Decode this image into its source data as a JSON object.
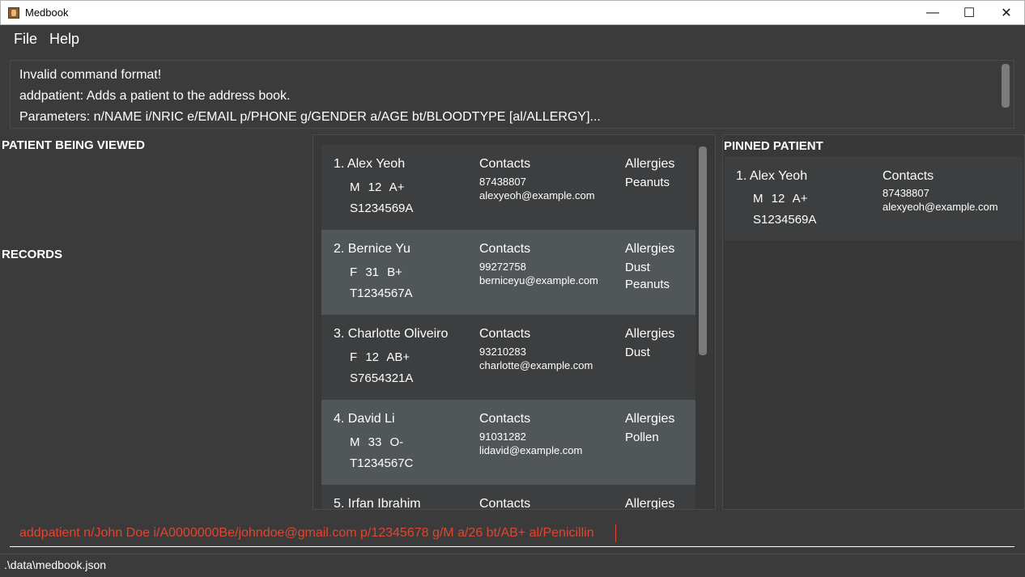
{
  "window": {
    "title": "Medbook",
    "minimize": "—",
    "maximize": "☐",
    "close": "✕"
  },
  "menu": {
    "file": "File",
    "help": "Help"
  },
  "result": {
    "line1": "Invalid command format!",
    "line2": "addpatient: Adds a patient to the address book.",
    "line3": "Parameters: n/NAME i/NRIC e/EMAIL p/PHONE g/GENDER a/AGE bt/BLOODTYPE [al/ALLERGY]..."
  },
  "left": {
    "viewing_label": "PATIENT BEING VIEWED",
    "records_label": "RECORDS"
  },
  "labels": {
    "contacts": "Contacts",
    "allergies": "Allergies"
  },
  "patients": [
    {
      "name": "1. Alex Yeoh",
      "meta": "M 12 A+",
      "nric": "S1234569A",
      "phone": "87438807",
      "email": "alexyeoh@example.com",
      "allergies": [
        "Peanuts"
      ]
    },
    {
      "name": "2. Bernice Yu",
      "meta": "F 31 B+",
      "nric": "T1234567A",
      "phone": "99272758",
      "email": "berniceyu@example.com",
      "allergies": [
        "Dust",
        "Peanuts"
      ]
    },
    {
      "name": "3. Charlotte Oliveiro",
      "meta": "F 12 AB+",
      "nric": "S7654321A",
      "phone": "93210283",
      "email": "charlotte@example.com",
      "allergies": [
        "Dust"
      ]
    },
    {
      "name": "4. David Li",
      "meta": "M 33 O-",
      "nric": "T1234567C",
      "phone": "91031282",
      "email": "lidavid@example.com",
      "allergies": [
        "Pollen"
      ]
    }
  ],
  "partial_card": {
    "name": "5. Irfan Ibrahim",
    "contacts": "Contacts",
    "allergies": "Allergies"
  },
  "pinned": {
    "label": "PINNED PATIENT",
    "name": "1. Alex Yeoh",
    "meta": "M 12 A+",
    "nric": "S1234569A",
    "contacts": "Contacts",
    "phone": "87438807",
    "email": "alexyeoh@example.com"
  },
  "command": {
    "value": "addpatient n/John Doe i/A0000000Be/johndoe@gmail.com p/12345678 g/M a/26 bt/AB+ al/Penicillin"
  },
  "status": {
    "path": ".\\data\\medbook.json"
  },
  "colors": {
    "command_text": "#e2452f",
    "card_dark": "#3c3e3f",
    "card_light": "#515658"
  }
}
